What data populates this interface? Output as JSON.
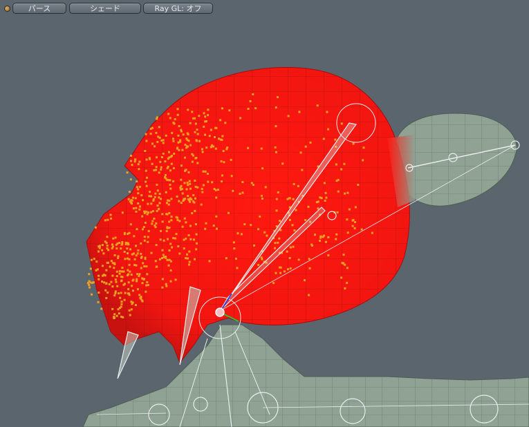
{
  "toolbar": {
    "view_label": "パース",
    "shading_label": "シェード",
    "raygl_label": "Ray GL: オフ"
  },
  "colors": {
    "background": "#5b656e",
    "selected_mesh": "#ff1a10",
    "unselected_mesh": "#8fa293",
    "vertex_points": "#f0a020",
    "bones": "#d0d8d8"
  },
  "icons": {
    "menu_indicator": "viewport-menu-dot-icon",
    "bone_pivot": "bone-pivot-icon",
    "transform_gizmo": "transform-gizmo-icon"
  }
}
